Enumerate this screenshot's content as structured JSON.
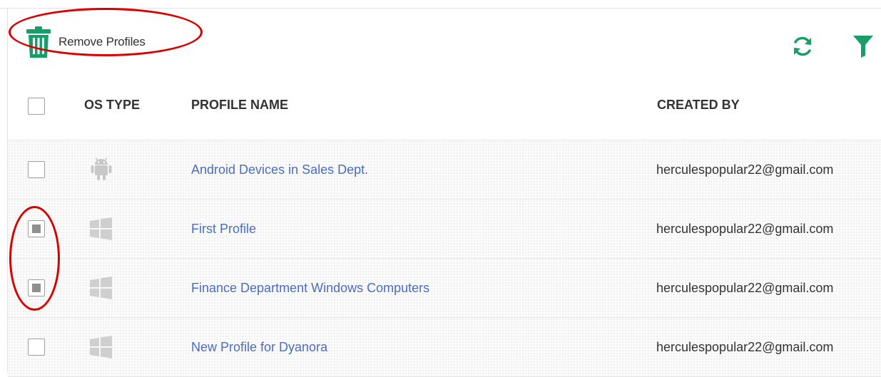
{
  "toolbar": {
    "remove_label": "Remove Profiles",
    "remove_icon": "trash-icon",
    "refresh_icon": "refresh-icon",
    "filter_icon": "filter-icon",
    "accent_color": "#1a9e69"
  },
  "table": {
    "columns": {
      "os_type": "OS TYPE",
      "profile_name": "PROFILE NAME",
      "created_by": "CREATED BY"
    },
    "select_all_checked": false,
    "rows": [
      {
        "os": "android",
        "icon": "android-icon",
        "name": "Android Devices in Sales Dept.",
        "created_by": "herculespopular22@gmail.com",
        "checked": false
      },
      {
        "os": "windows",
        "icon": "windows-icon",
        "name": "First Profile",
        "created_by": "herculespopular22@gmail.com",
        "checked": true
      },
      {
        "os": "windows",
        "icon": "windows-icon",
        "name": "Finance Department Windows Computers",
        "created_by": "herculespopular22@gmail.com",
        "checked": true
      },
      {
        "os": "windows",
        "icon": "windows-icon",
        "name": "New Profile for Dyanora",
        "created_by": "herculespopular22@gmail.com",
        "checked": false
      }
    ]
  },
  "colors": {
    "link": "#4b6cc1",
    "annotation": "#d90000",
    "icon_gray": "#c8c8c8"
  }
}
